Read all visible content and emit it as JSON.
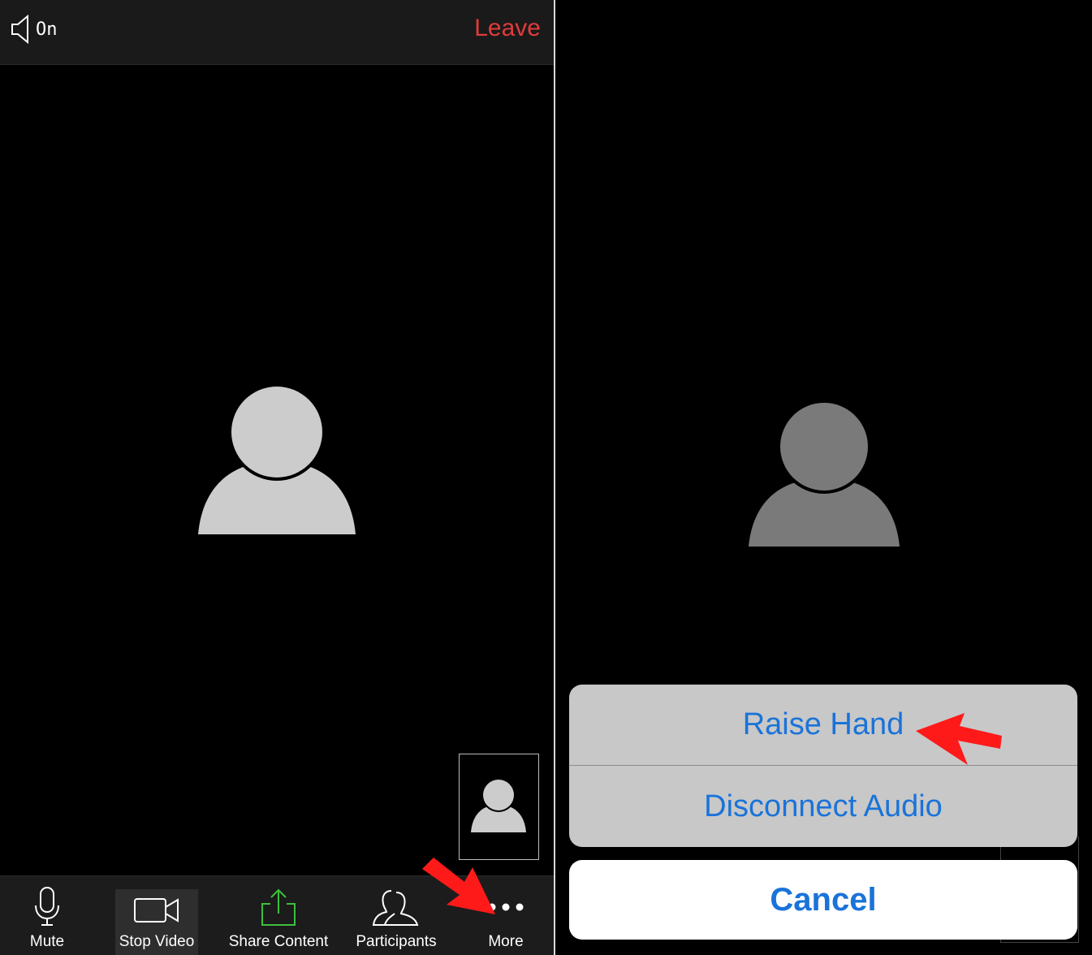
{
  "left_screen": {
    "top_bar": {
      "speaker_icon": "speaker-icon",
      "speaker_status": "On",
      "leave_label": "Leave",
      "leave_color": "#e23b3b"
    },
    "toolbar": {
      "items": [
        {
          "label": "Mute",
          "icon": "microphone-icon"
        },
        {
          "label": "Stop Video",
          "icon": "video-camera-icon"
        },
        {
          "label": "Share Content",
          "icon": "share-upload-icon"
        },
        {
          "label": "Participants",
          "icon": "participants-icon"
        },
        {
          "label": "More",
          "icon": "more-dots-icon"
        }
      ]
    }
  },
  "right_screen": {
    "action_sheet": {
      "items": [
        {
          "label": "Raise Hand"
        },
        {
          "label": "Disconnect Audio"
        }
      ],
      "cancel_label": "Cancel",
      "accent_color": "#1a73d9"
    }
  },
  "annotations": {
    "arrow_color": "#ff1a1a"
  }
}
